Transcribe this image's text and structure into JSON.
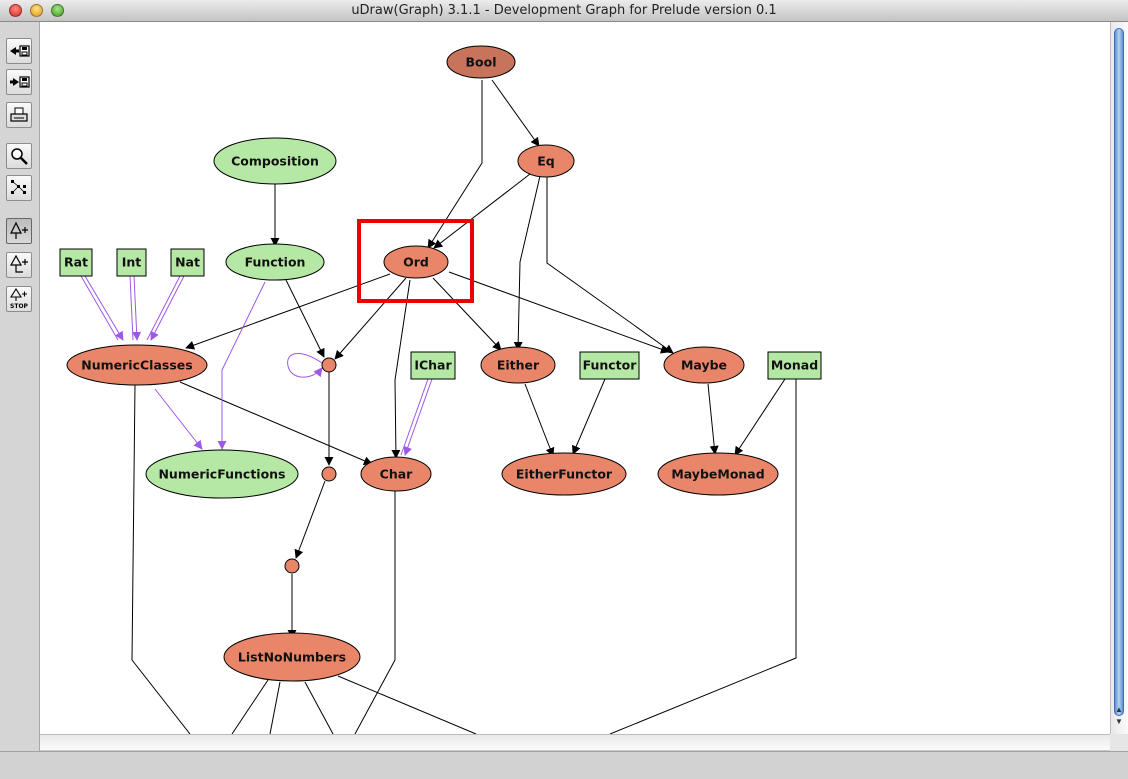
{
  "window": {
    "title": "uDraw(Graph) 3.1.1 - Development Graph for Prelude version 0.1"
  },
  "toolbar": {
    "buttons": [
      {
        "icon": "load-graph-icon"
      },
      {
        "icon": "save-graph-icon"
      },
      {
        "icon": "print-icon"
      },
      {
        "icon": "zoom-icon"
      },
      {
        "icon": "layout-graph-icon"
      },
      {
        "icon": "tree-layout-icon"
      },
      {
        "icon": "improve-layout-icon"
      },
      {
        "icon": "stop-icon",
        "label": "STOP"
      }
    ]
  },
  "graph": {
    "colors": {
      "salmon": "#E9866A",
      "dark_salmon": "#C8735C",
      "green": "#B5E8A4",
      "edge": "#000000",
      "hiding_edge": "#9B59E6",
      "highlight": "#EE0000"
    },
    "nodes": {
      "bool": "Bool",
      "eq": "Eq",
      "composition": "Composition",
      "function": "Function",
      "ord": "Ord",
      "rat": "Rat",
      "int": "Int",
      "nat": "Nat",
      "numeric_classes": "NumericClasses",
      "ichar": "IChar",
      "either": "Either",
      "functor": "Functor",
      "maybe": "Maybe",
      "monad": "Monad",
      "numeric_functions": "NumericFunctions",
      "char": "Char",
      "either_functor": "EitherFunctor",
      "maybe_monad": "MaybeMonad",
      "list_no_numbers": "ListNoNumbers"
    }
  }
}
